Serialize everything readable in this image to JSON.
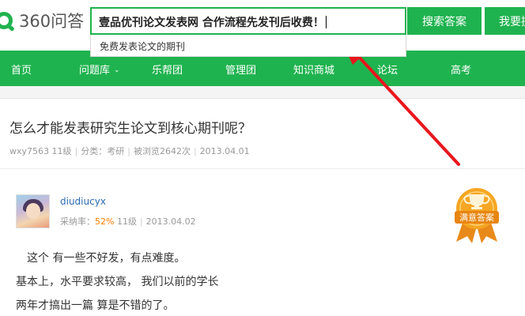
{
  "logo": {
    "text": "360问答"
  },
  "search": {
    "value": "壹品优刊论文发表网   合作流程先发刊后收费！",
    "suggestion": "免费发表论文的期刊",
    "search_button": "搜索答案",
    "ask_button": "我要提问"
  },
  "nav": {
    "items": [
      "首页",
      "问题库",
      "乐帮团",
      "管理团",
      "知识商城",
      "论坛",
      "高考"
    ]
  },
  "question": {
    "title": "怎么才能发表研究生论文到核心期刊呢？",
    "author": "wxy7563",
    "level": "11级",
    "category": "分类：考研",
    "views": "被浏览2642次",
    "date": "2013.04.01"
  },
  "answer": {
    "name": "diudiucyx",
    "rate_label": "采纳率：",
    "rate_value": "52%",
    "level": "11级",
    "date": "2013.04.02",
    "badge": "满意答案",
    "lines": [
      "这个 有一些不好发，有点难度。",
      "基本上，水平要求较高， 我们以前的学长",
      "两年才搞出一篇 算是不错的了。"
    ]
  },
  "colors": {
    "brand_green": "#1fb34f",
    "arrow_red": "#e8161c",
    "badge_orange": "#f5a623"
  }
}
